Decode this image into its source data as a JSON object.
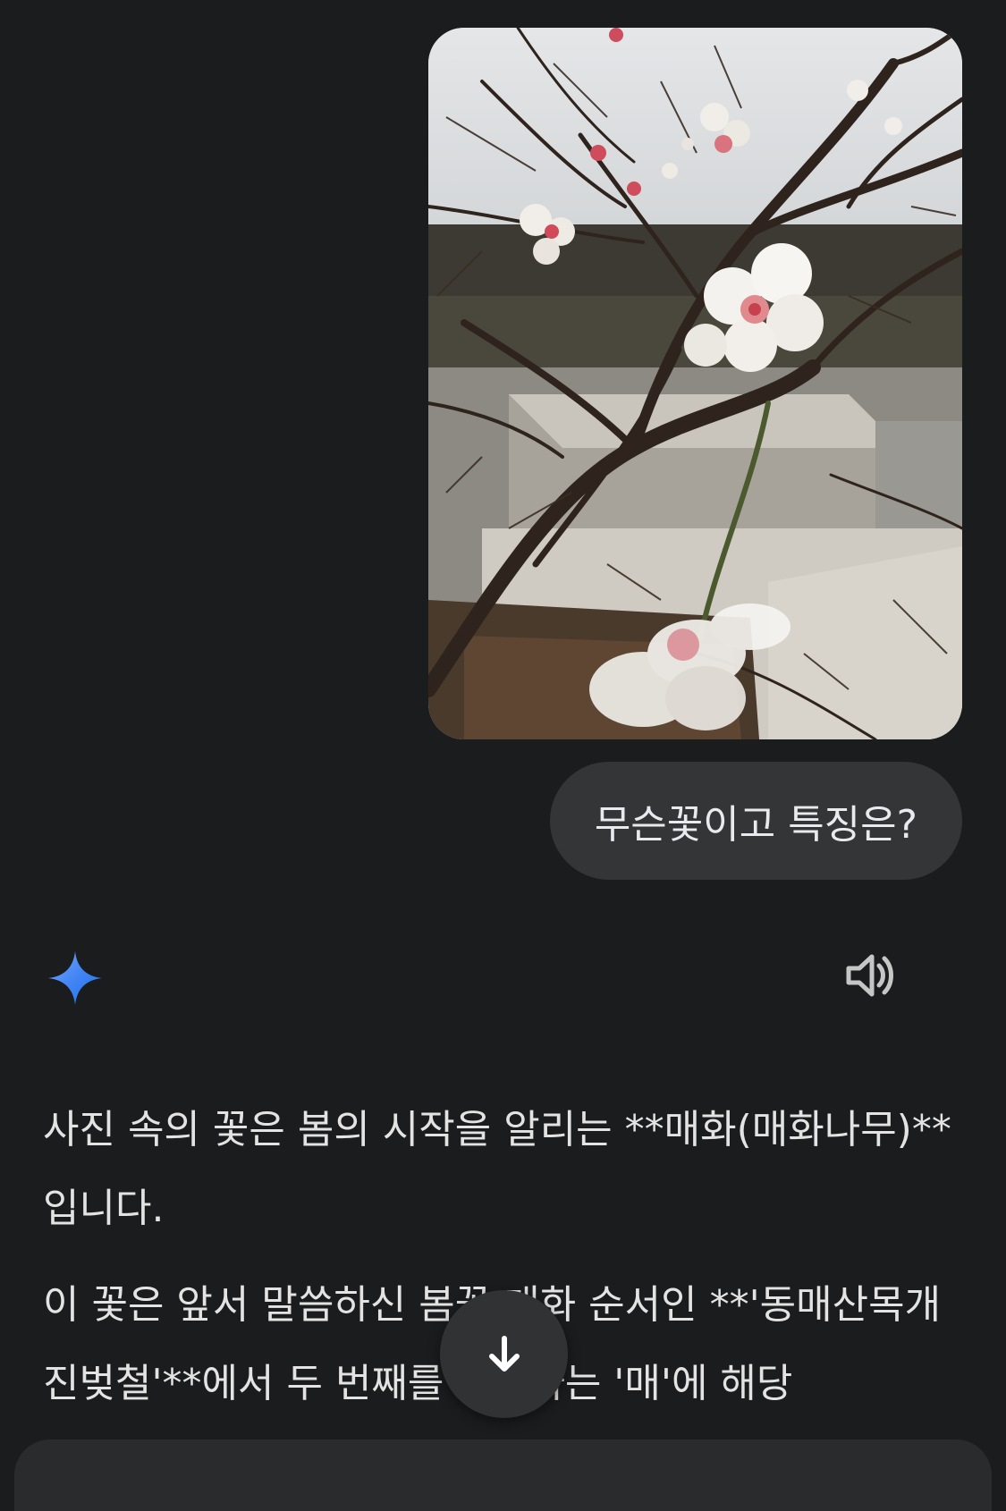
{
  "user_message": {
    "photo_alt": "image",
    "text": "무슨꽃이고 특징은?"
  },
  "assistant": {
    "logo_icon": "gemini-spark-icon",
    "logo_colors": [
      "#4285f4",
      "#1a73e8",
      "#7aa7ff"
    ],
    "speaker_icon": "speaker-icon",
    "paragraphs": [
      "사진 속의 꽃은 봄의 시작을 알리는 **매화(매화나무)**입니다.",
      "이 꽃은 앞서 말씀하신 봄꽃 개화 순서인 **'동매산목개진벚철'**에서 두 번째를 차지하는 '매'에 해당"
    ]
  },
  "scroll_button": {
    "icon": "arrow-down-icon"
  },
  "colors": {
    "background": "#1b1c1d",
    "bubble": "#333537",
    "text": "#e3e3e3",
    "fab": "#303234"
  }
}
